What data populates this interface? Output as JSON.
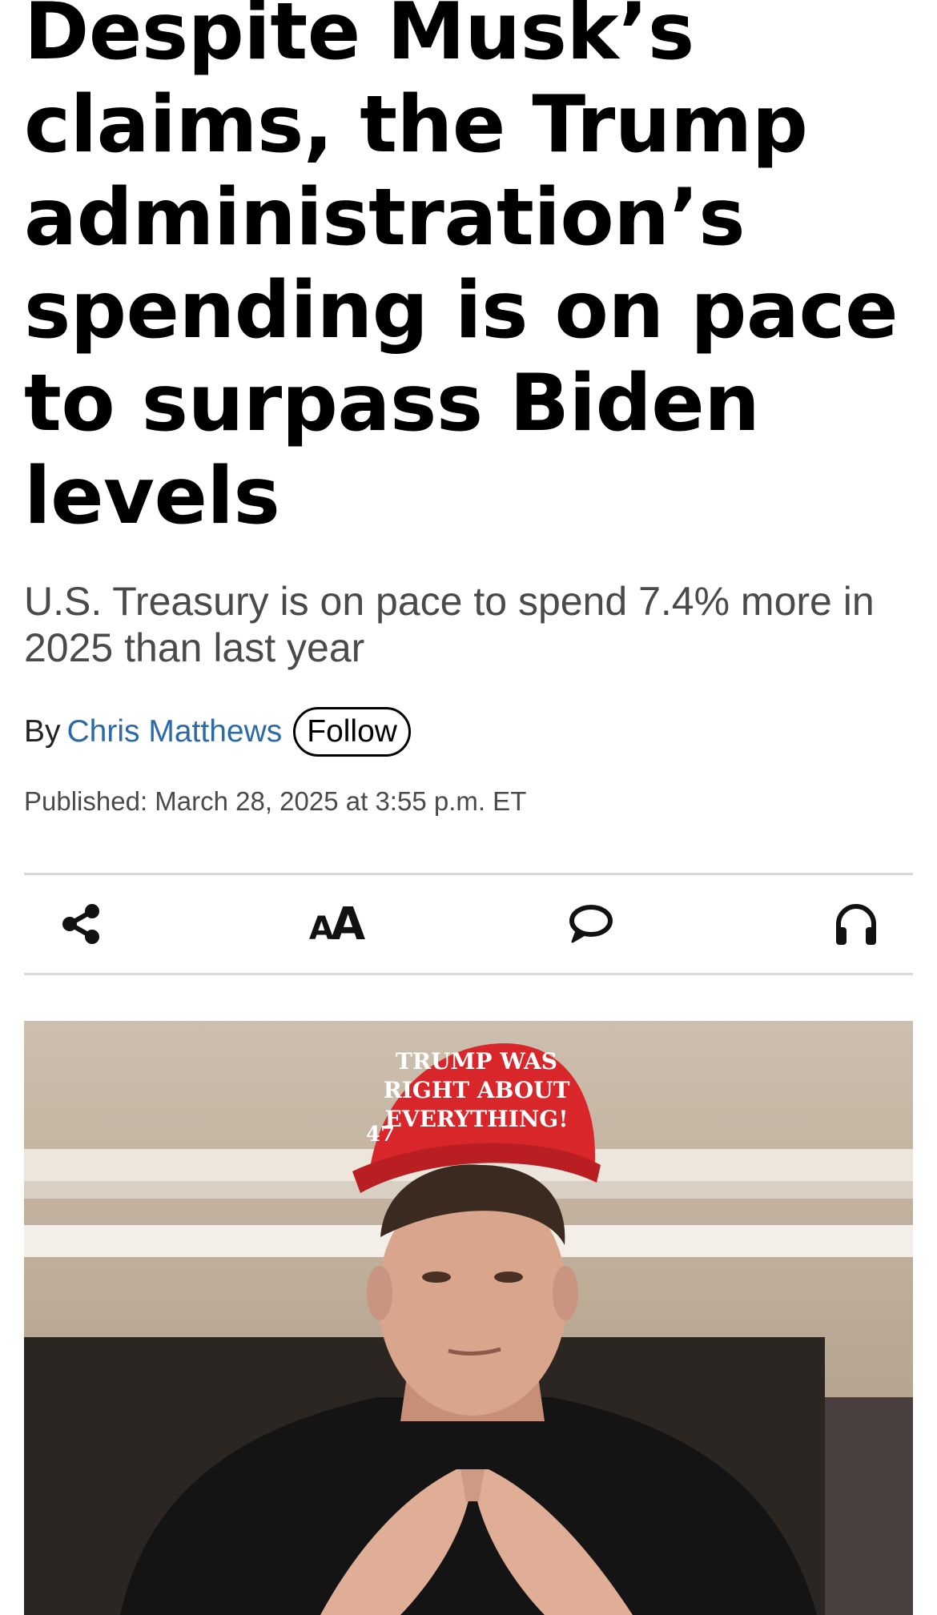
{
  "article": {
    "headline": "Despite Musk’s claims, the Trump administration’s spending is on pace to surpass Biden levels",
    "dek": "U.S. Treasury is on pace to spend 7.4% more in 2025 than last year",
    "byline": {
      "prefix": "By",
      "author": "Chris Matthews",
      "follow_label": "Follow"
    },
    "published": "Published: March 28, 2025 at 3:55 p.m. ET"
  },
  "toolbar": {
    "items": [
      {
        "icon": "share-icon"
      },
      {
        "icon": "text-size-icon"
      },
      {
        "icon": "comment-icon"
      },
      {
        "icon": "headphones-icon"
      }
    ]
  },
  "hero_image": {
    "cap_text_line1": "TRUMP WAS",
    "cap_text_line2": "RIGHT ABOUT",
    "cap_text_line3": "EVERYTHING!",
    "cap_number": "47",
    "colors": {
      "cap": "#d8262a",
      "wall": "#b8a690",
      "jacket": "#141414",
      "skin": "#d9a58c"
    }
  }
}
